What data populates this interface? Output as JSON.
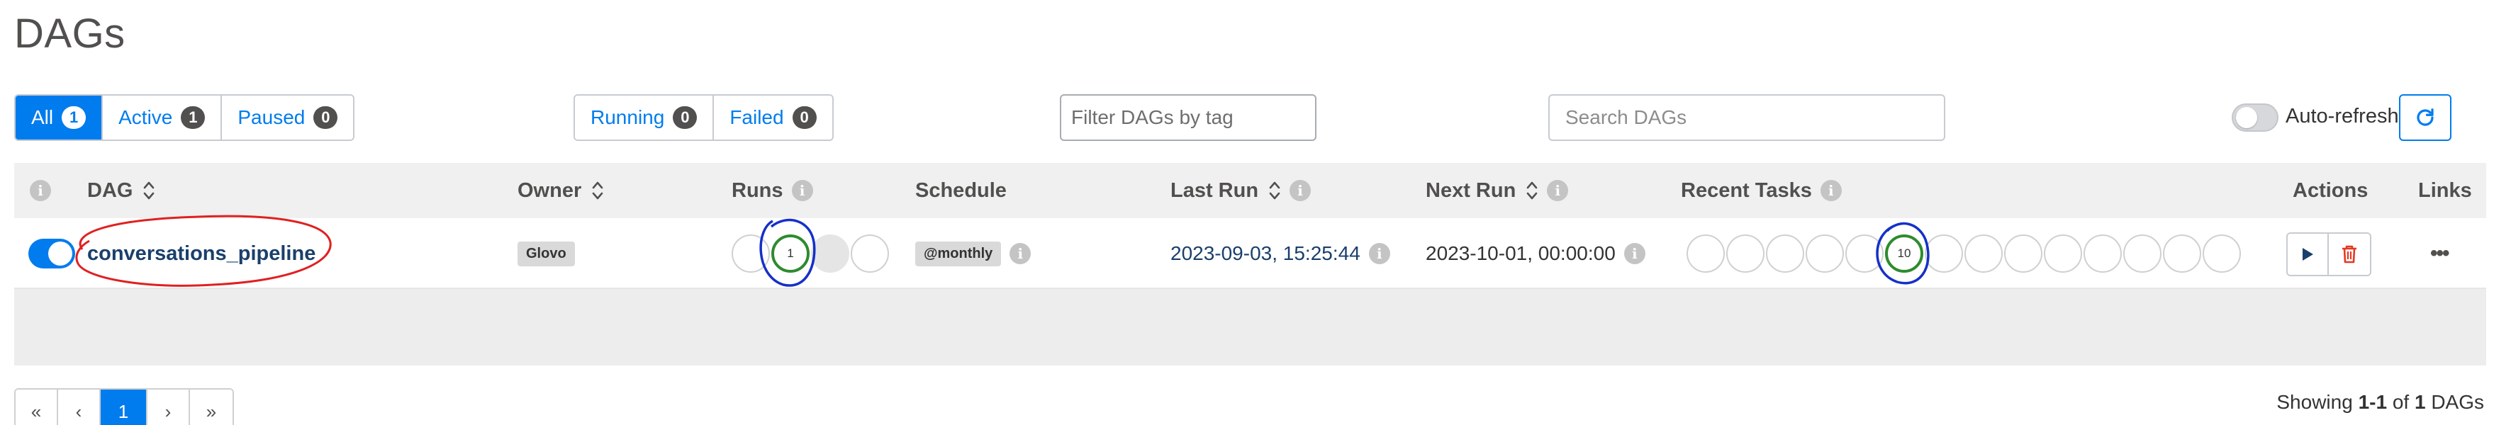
{
  "page_title": "DAGs",
  "filters": {
    "status_tabs": [
      {
        "label": "All",
        "count": "1",
        "active": true
      },
      {
        "label": "Active",
        "count": "1",
        "active": false
      },
      {
        "label": "Paused",
        "count": "0",
        "active": false
      }
    ],
    "run_tabs": [
      {
        "label": "Running",
        "count": "0"
      },
      {
        "label": "Failed",
        "count": "0"
      }
    ],
    "tag_filter_placeholder": "Filter DAGs by tag",
    "search_placeholder": "Search DAGs",
    "auto_refresh_label": "Auto-refresh",
    "auto_refresh_enabled": false
  },
  "table": {
    "headers": {
      "dag": "DAG",
      "owner": "Owner",
      "runs": "Runs",
      "schedule": "Schedule",
      "last_run": "Last Run",
      "next_run": "Next Run",
      "recent_tasks": "Recent Tasks",
      "actions": "Actions",
      "links": "Links"
    },
    "rows": [
      {
        "enabled": true,
        "dag_id": "conversations_pipeline",
        "owner": "Glovo",
        "runs_success_count": "1",
        "schedule": "@monthly",
        "last_run": "2023-09-03, 15:25:44",
        "next_run": "2023-10-01, 00:00:00",
        "recent_tasks_success_count": "10",
        "links_menu": "•••"
      }
    ]
  },
  "pagination": {
    "first": "«",
    "prev": "‹",
    "current": "1",
    "next": "›",
    "last": "»"
  },
  "showing": {
    "prefix": "Showing",
    "range": "1-1",
    "of": "of",
    "total": "1",
    "suffix": "DAGs"
  },
  "colors": {
    "accent": "#017cee",
    "success": "#2e8b2e",
    "annotation_red": "#e02020",
    "annotation_blue": "#1530c8",
    "delete": "#e43921"
  },
  "icons": {
    "refresh": "refresh-icon",
    "trigger": "play-icon",
    "delete": "trash-icon",
    "info": "info-icon",
    "sort": "sort-icon"
  }
}
